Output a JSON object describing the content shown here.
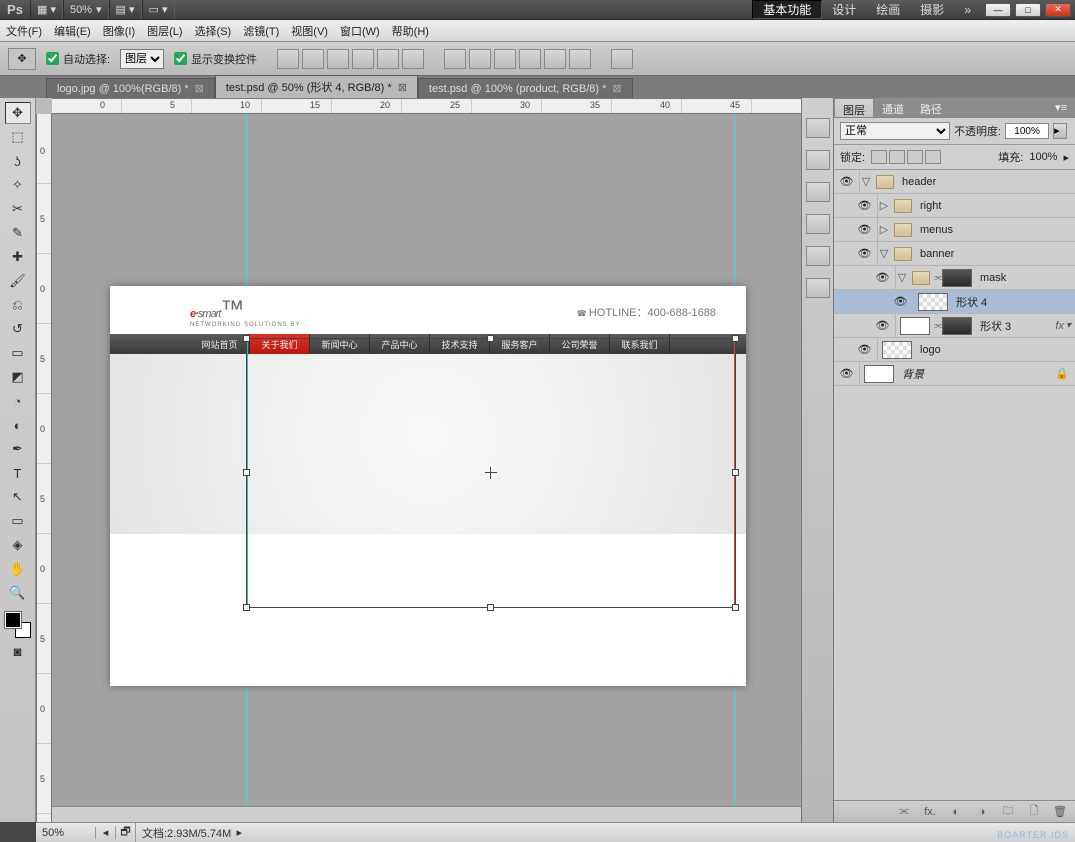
{
  "app_bar": {
    "ps_label": "Ps",
    "zoom_label": "50%",
    "workspaces": [
      "基本功能",
      "设计",
      "绘画",
      "摄影"
    ]
  },
  "menu": {
    "file": "文件(F)",
    "edit": "编辑(E)",
    "image": "图像(I)",
    "layer": "图层(L)",
    "select": "选择(S)",
    "filter": "滤镜(T)",
    "view": "视图(V)",
    "window": "窗口(W)",
    "help": "帮助(H)"
  },
  "options": {
    "auto_select": "自动选择:",
    "auto_select_value": "图层",
    "show_transform": "显示变换控件"
  },
  "doc_tabs": [
    {
      "label": "logo.jpg @ 100%(RGB/8) *"
    },
    {
      "label": "test.psd @ 50% (形状 4, RGB/8) *"
    },
    {
      "label": "test.psd @ 100% (product, RGB/8) *"
    }
  ],
  "ruler_top": [
    "0",
    "5",
    "10",
    "15",
    "20",
    "25",
    "30",
    "35",
    "40",
    "45"
  ],
  "ruler_left": [
    "0",
    "5",
    "0",
    "5",
    "0",
    "5",
    "0",
    "5",
    "0",
    "5"
  ],
  "mockup": {
    "logo_main": "smart",
    "logo_tag": "NETWORKING SOLUTIONS BY",
    "hotline": "HOTLINE：400-688-1688",
    "nav": [
      "网站首页",
      "关于我们",
      "新闻中心",
      "产品中心",
      "技术支持",
      "服务客户",
      "公司荣誉",
      "联系我们"
    ]
  },
  "panel": {
    "tabs": [
      "图层",
      "通道",
      "路径"
    ],
    "blend_mode": "正常",
    "opacity_label": "不透明度:",
    "opacity_value": "100%",
    "lock_label": "锁定:",
    "fill_label": "填充:",
    "fill_value": "100%"
  },
  "layers": {
    "header": "header",
    "right": "right",
    "menus": "menus",
    "banner": "banner",
    "mask": "mask",
    "shape4": "形状 4",
    "shape3": "形状 3",
    "fx": "fx",
    "logo": "logo",
    "bg": "背景"
  },
  "status": {
    "zoom": "50%",
    "doc": "文档:2.93M/5.74M"
  },
  "watermark": "BOARTER.IDS"
}
